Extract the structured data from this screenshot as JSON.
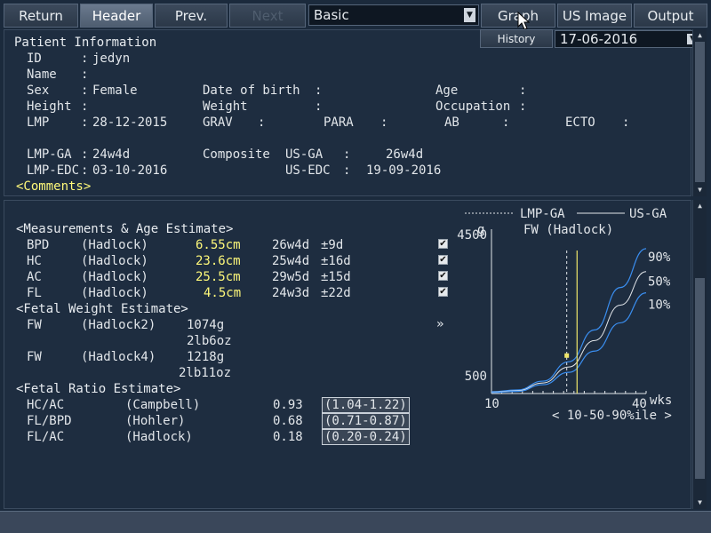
{
  "toolbar": {
    "return_label": "Return",
    "header_label": "Header",
    "prev_label": "Prev.",
    "next_label": "Next",
    "mode_value": "Basic",
    "graph_label": "Graph",
    "us_image_label": "US Image",
    "output_label": "Output",
    "history_label": "History",
    "date_value": "17-06-2016"
  },
  "patient": {
    "section_title": "Patient Information",
    "id_label": "ID",
    "id_value": "jedyn",
    "name_label": "Name",
    "name_value": "",
    "sex_label": "Sex",
    "sex_value": "Female",
    "dob_label": "Date of birth",
    "dob_value": "",
    "age_label": "Age",
    "age_value": "",
    "height_label": "Height",
    "height_value": "",
    "weight_label": "Weight",
    "weight_value": "",
    "occupation_label": "Occupation",
    "occupation_value": "",
    "lmp_label": "LMP",
    "lmp_value": "28-12-2015",
    "grav_label": "GRAV",
    "para_label": "PARA",
    "ab_label": "AB",
    "ecto_label": "ECTO",
    "lmp_ga_label": "LMP-GA",
    "lmp_ga_value": "24w4d",
    "lmp_edc_label": "LMP-EDC",
    "lmp_edc_value": "03-10-2016",
    "composite_label": "Composite",
    "us_ga_label": "US-GA",
    "us_ga_value": "26w4d",
    "us_edc_label": "US-EDC",
    "us_edc_value": "19-09-2016",
    "comments_label": "<Comments>"
  },
  "measurements": {
    "title": "<Measurements & Age Estimate>",
    "rows": [
      {
        "name": "BPD",
        "method": "(Hadlock)",
        "value": "6.55cm",
        "ga": "26w4d",
        "sd": "±9d"
      },
      {
        "name": "HC",
        "method": "(Hadlock)",
        "value": "23.6cm",
        "ga": "25w4d",
        "sd": "±16d"
      },
      {
        "name": "AC",
        "method": "(Hadlock)",
        "value": "25.5cm",
        "ga": "29w5d",
        "sd": "±15d"
      },
      {
        "name": "FL",
        "method": "(Hadlock)",
        "value": "4.5cm",
        "ga": "24w3d",
        "sd": "±22d"
      }
    ]
  },
  "fetal_weight": {
    "title": "<Fetal Weight Estimate>",
    "rows": [
      {
        "name": "FW",
        "method": "(Hadlock2)",
        "grams": "1074g",
        "lboz": "2lb6oz"
      },
      {
        "name": "FW",
        "method": "(Hadlock4)",
        "grams": "1218g",
        "lboz": "2lb11oz"
      }
    ],
    "more_glyph": "»"
  },
  "fetal_ratio": {
    "title": "<Fetal Ratio Estimate>",
    "rows": [
      {
        "name": "HC/AC",
        "method": "(Campbell)",
        "value": "0.93",
        "range": "(1.04-1.22)"
      },
      {
        "name": "FL/BPD",
        "method": "(Hohler)",
        "value": "0.68",
        "range": "(0.71-0.87)"
      },
      {
        "name": "FL/AC",
        "method": "(Hadlock)",
        "value": "0.18",
        "range": "(0.20-0.24)"
      }
    ]
  },
  "chart_data": {
    "type": "line",
    "title": "FW (Hadlock)",
    "legend": [
      "LMP-GA",
      "US-GA"
    ],
    "ylabel": "g",
    "xlabel": "wks",
    "xlim": [
      10,
      40
    ],
    "ylim": [
      0,
      4500
    ],
    "x_ticks": [
      "10",
      "40"
    ],
    "y_ticks": [
      "500",
      "4500"
    ],
    "series": [
      {
        "name": "90%",
        "x": [
          10,
          15,
          20,
          25,
          30,
          35,
          40
        ],
        "values": [
          50,
          100,
          350,
          900,
          1800,
          3000,
          4100
        ]
      },
      {
        "name": "50%",
        "x": [
          10,
          15,
          20,
          25,
          30,
          35,
          40
        ],
        "values": [
          40,
          80,
          300,
          750,
          1500,
          2500,
          3450
        ]
      },
      {
        "name": "10%",
        "x": [
          10,
          15,
          20,
          25,
          30,
          35,
          40
        ],
        "values": [
          30,
          60,
          250,
          600,
          1200,
          2000,
          2850
        ]
      }
    ],
    "lmp_ga_week": 24.6,
    "us_ga_week": 26.6,
    "point": {
      "x": 26.6,
      "y": 1074
    },
    "footer": "< 10-50-90%ile >"
  },
  "colors": {
    "highlight": "#fff97a",
    "curve": "#3a8ef0",
    "marker": "#f0e66a"
  }
}
